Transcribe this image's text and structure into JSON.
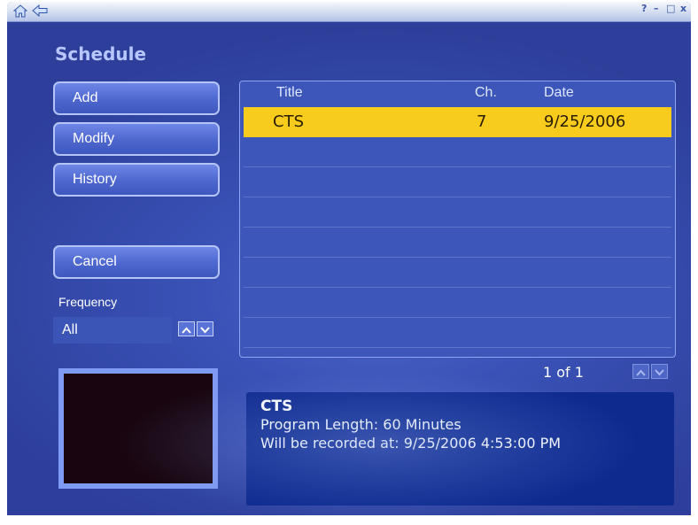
{
  "screen": {
    "title": "Schedule"
  },
  "titlebar": {
    "help": "?",
    "minimize": "–",
    "maximize": "□",
    "close": "x",
    "icons": [
      "home-icon",
      "back-arrow-icon"
    ]
  },
  "sidebar": {
    "add_label": "Add",
    "modify_label": "Modify",
    "history_label": "History",
    "cancel_label": "Cancel",
    "frequency": {
      "label": "Frequency",
      "value": "All",
      "up": "up-chevron-icon",
      "down": "down-chevron-icon"
    }
  },
  "list": {
    "columns": {
      "title": "Title",
      "channel": "Ch.",
      "date": "Date"
    },
    "rows": [
      {
        "title": "CTS",
        "channel": "7",
        "date": "9/25/2006",
        "selected": true
      }
    ],
    "empty_rows": 7,
    "page_indicator": "1 of 1"
  },
  "details": {
    "title": "CTS",
    "length": "Program Length: 60 Minutes",
    "recorded_at": "Will be recorded at: 9/25/2006 4:53:00 PM"
  },
  "colors": {
    "selected_row": "#f8cc1c",
    "details_bg": "#0d2a8f",
    "title": "#b8c6ff"
  }
}
